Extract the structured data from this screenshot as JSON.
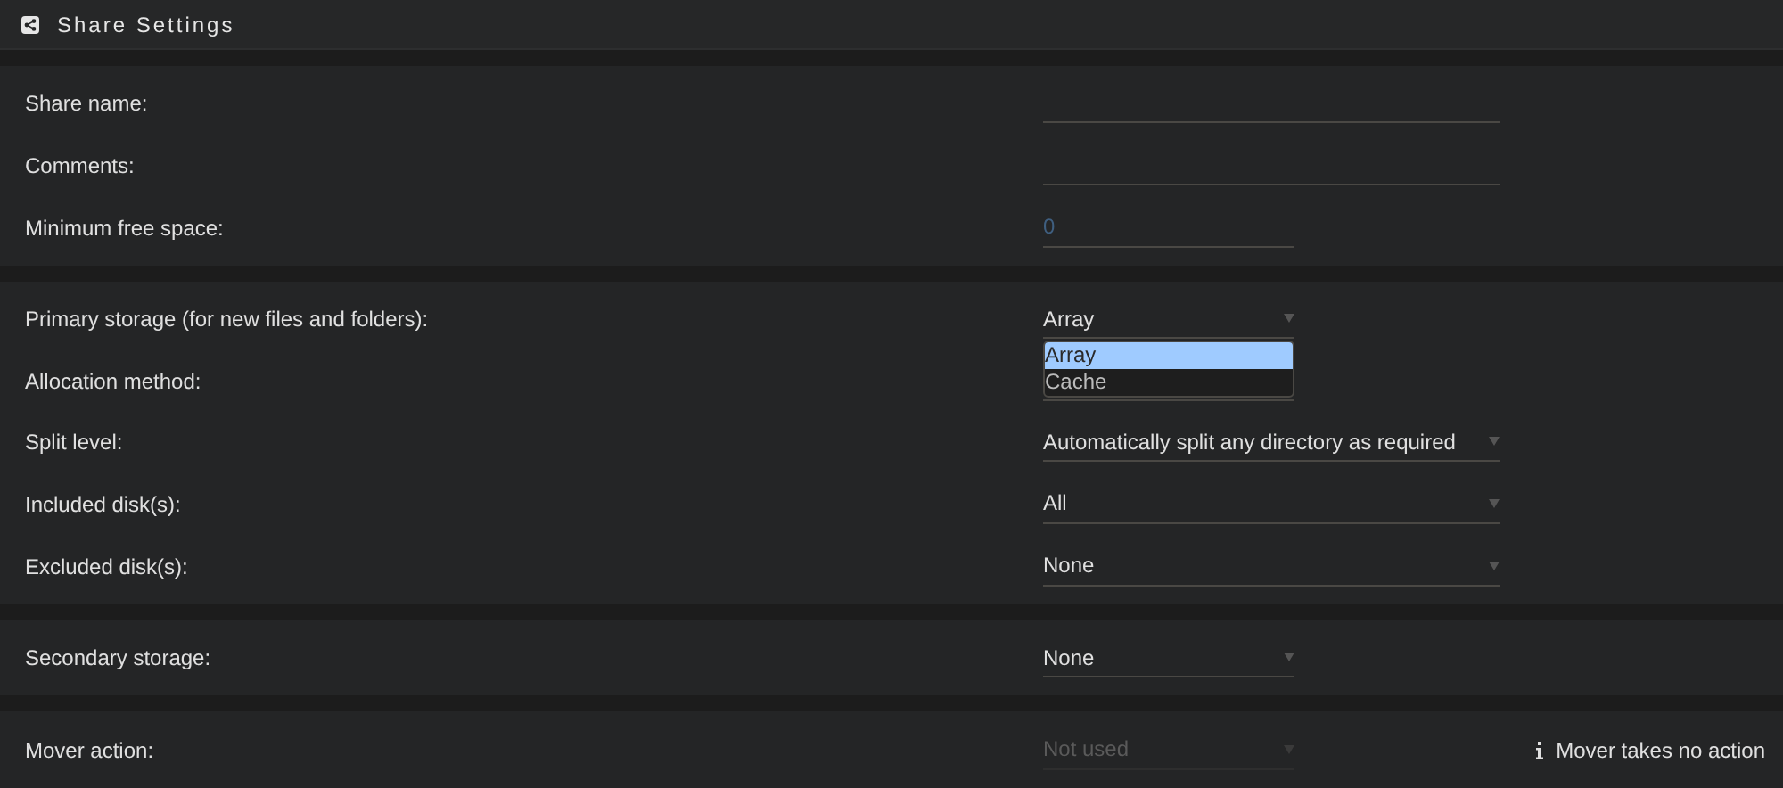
{
  "header": {
    "title": "Share Settings"
  },
  "sections": [
    {
      "rows": [
        {
          "label": "Share name:",
          "kind": "text"
        },
        {
          "label": "Comments:",
          "kind": "text"
        },
        {
          "label": "Minimum free space:",
          "kind": "number",
          "placeholder": "0"
        }
      ]
    },
    {
      "rows": [
        {
          "label": "Primary storage (for new files and folders):",
          "kind": "select",
          "value": "Array",
          "disabled": false,
          "options": [
            {
              "label": "Array",
              "selected": true
            },
            {
              "label": "Cache",
              "selected": false
            }
          ]
        },
        {
          "label": "Allocation method:",
          "kind": "covered"
        },
        {
          "label": "Split level:",
          "kind": "longselect",
          "value": "Automatically split any directory as required",
          "disabled": false
        },
        {
          "label": "Included disk(s):",
          "kind": "longselect",
          "value": "All",
          "disabled": false
        },
        {
          "label": "Excluded disk(s):",
          "kind": "longselect",
          "value": "None",
          "disabled": false
        }
      ]
    },
    {
      "rows": [
        {
          "label": "Secondary storage:",
          "kind": "select",
          "value": "None",
          "disabled": false
        }
      ]
    },
    {
      "rows": [
        {
          "label": "Mover action:",
          "kind": "select",
          "value": "Not used",
          "disabled": true,
          "note": "Mover takes no action"
        }
      ]
    }
  ]
}
